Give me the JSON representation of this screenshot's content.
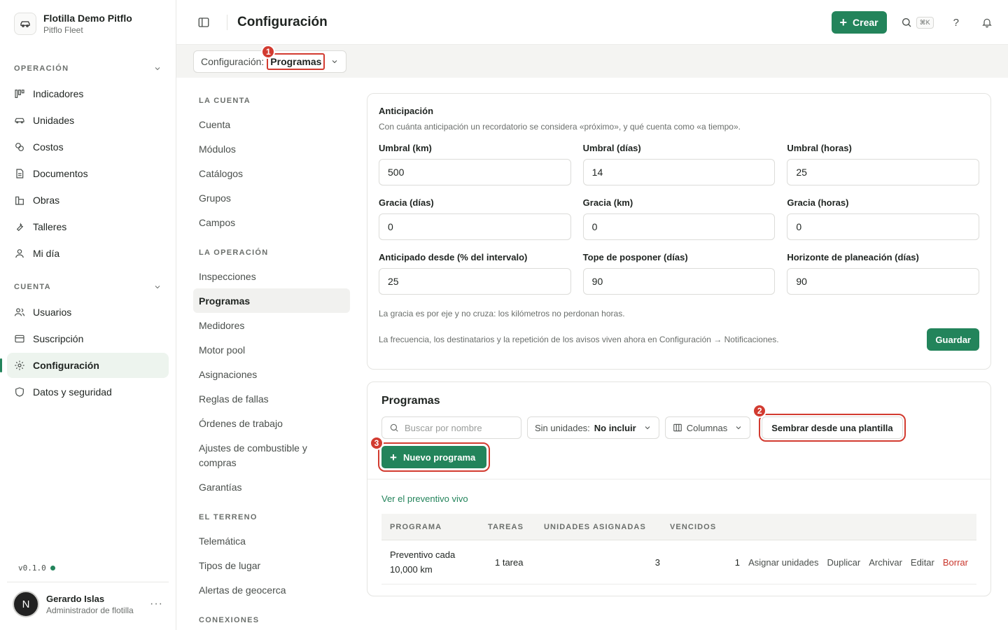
{
  "org": {
    "name": "Flotilla Demo Pitflo",
    "sub": "Pitflo Fleet"
  },
  "sidebar": {
    "sections": [
      {
        "title": "OPERACIÓN",
        "items": [
          {
            "label": "Indicadores",
            "icon": "chart-icon"
          },
          {
            "label": "Unidades",
            "icon": "car-icon"
          },
          {
            "label": "Costos",
            "icon": "coins-icon"
          },
          {
            "label": "Documentos",
            "icon": "document-icon"
          },
          {
            "label": "Obras",
            "icon": "building-icon"
          },
          {
            "label": "Talleres",
            "icon": "wrench-icon"
          },
          {
            "label": "Mi día",
            "icon": "user-icon"
          }
        ]
      },
      {
        "title": "CUENTA",
        "items": [
          {
            "label": "Usuarios",
            "icon": "users-icon"
          },
          {
            "label": "Suscripción",
            "icon": "card-icon"
          },
          {
            "label": "Configuración",
            "icon": "gear-icon",
            "active": true
          },
          {
            "label": "Datos y seguridad",
            "icon": "shield-icon"
          }
        ]
      }
    ],
    "version": "v0.1.0",
    "user": {
      "initial": "N",
      "name": "Gerardo Islas",
      "role": "Administrador de flotilla",
      "more": "···"
    }
  },
  "topbar": {
    "title": "Configuración",
    "create_label": "Crear",
    "kbd": "⌘K",
    "help": "?"
  },
  "crumb": {
    "prefix": "Configuración:",
    "value": "Programas"
  },
  "annotations": {
    "one": "1",
    "two": "2",
    "three": "3"
  },
  "subnav": {
    "groups": [
      {
        "title": "LA CUENTA",
        "items": [
          "Cuenta",
          "Módulos",
          "Catálogos",
          "Grupos",
          "Campos"
        ]
      },
      {
        "title": "LA OPERACIÓN",
        "items": [
          "Inspecciones",
          "Programas",
          "Medidores",
          "Motor pool",
          "Asignaciones",
          "Reglas de fallas",
          "Órdenes de trabajo",
          "Ajustes de combustible y compras",
          "Garantías"
        ]
      },
      {
        "title": "EL TERRENO",
        "items": [
          "Telemática",
          "Tipos de lugar",
          "Alertas de geocerca"
        ]
      },
      {
        "title": "CONEXIONES",
        "items": []
      }
    ],
    "active": "Programas"
  },
  "anticipation": {
    "title": "Anticipación",
    "desc": "Con cuánta anticipación un recordatorio se considera «próximo», y qué cuenta como «a tiempo».",
    "fields": [
      {
        "label": "Umbral (km)",
        "value": "500"
      },
      {
        "label": "Umbral (días)",
        "value": "14"
      },
      {
        "label": "Umbral (horas)",
        "value": "25"
      },
      {
        "label": "Gracia (días)",
        "value": "0"
      },
      {
        "label": "Gracia (km)",
        "value": "0"
      },
      {
        "label": "Gracia (horas)",
        "value": "0"
      },
      {
        "label": "Anticipado desde (% del intervalo)",
        "value": "25"
      },
      {
        "label": "Tope de posponer (días)",
        "value": "90"
      },
      {
        "label": "Horizonte de planeación (días)",
        "value": "90"
      }
    ],
    "note": "La gracia es por eje y no cruza: los kilómetros no perdonan horas.",
    "footer_note": "La frecuencia, los destinatarios y la repetición de los avisos viven ahora en Configuración → Notificaciones.",
    "save_label": "Guardar"
  },
  "programs": {
    "title": "Programas",
    "search_placeholder": "Buscar por nombre",
    "filter_label": "Sin unidades:",
    "filter_value": "No incluir",
    "columns_label": "Columnas",
    "seed_label": "Sembrar desde una plantilla",
    "new_label": "Nuevo programa",
    "live_link": "Ver el preventivo vivo",
    "headers": [
      "PROGRAMA",
      "TAREAS",
      "UNIDADES ASIGNADAS",
      "VENCIDOS"
    ],
    "rows": [
      {
        "name": "Preventivo cada 10,000 km",
        "tasks": "1 tarea",
        "units": "3",
        "overdue": "1"
      }
    ],
    "actions": [
      "Asignar unidades",
      "Duplicar",
      "Archivar",
      "Editar",
      "Borrar"
    ]
  },
  "colors": {
    "accent": "#23845b",
    "annotation": "#d23b30",
    "danger": "#c9362c"
  }
}
